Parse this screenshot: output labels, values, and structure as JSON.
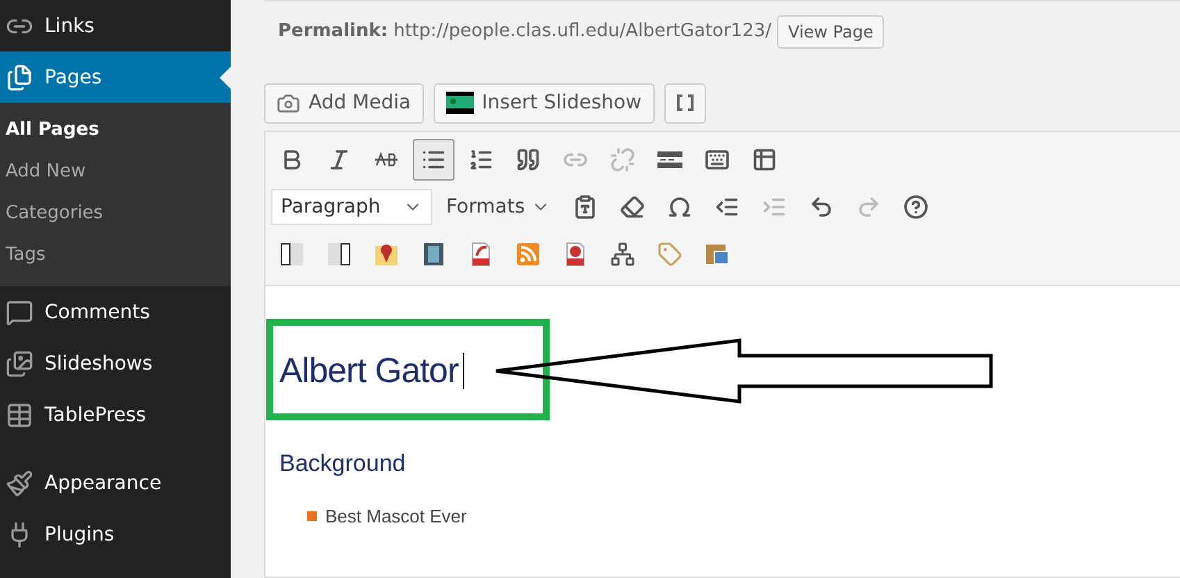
{
  "sidebar": {
    "groups": [
      [
        {
          "label": "Links",
          "kind": "link",
          "selected": false
        },
        {
          "label": "Pages",
          "kind": "pages",
          "selected": true,
          "children": [
            {
              "label": "All Pages",
              "selected": true
            },
            {
              "label": "Add New",
              "selected": false
            },
            {
              "label": "Categories",
              "selected": false
            },
            {
              "label": "Tags",
              "selected": false
            }
          ]
        },
        {
          "label": "Comments",
          "kind": "comment",
          "selected": false
        },
        {
          "label": "Slideshows",
          "kind": "slides",
          "selected": false
        },
        {
          "label": "TablePress",
          "kind": "table",
          "selected": false
        }
      ],
      [
        {
          "label": "Appearance",
          "kind": "brush",
          "selected": false
        },
        {
          "label": "Plugins",
          "kind": "plug",
          "selected": false
        }
      ]
    ]
  },
  "permalink": {
    "label": "Permalink:",
    "url": "http://people.clas.ufl.edu/AlbertGator123/",
    "button": "View Page"
  },
  "media_buttons": [
    {
      "kind": "media",
      "label": "Add Media"
    },
    {
      "kind": "slideshow",
      "label": "Insert Slideshow"
    },
    {
      "kind": "brackets"
    }
  ],
  "toolbar_row_1": [
    {
      "kind": "bold",
      "active": false,
      "disabled": false
    },
    {
      "kind": "italic",
      "active": false,
      "disabled": false
    },
    {
      "kind": "strike",
      "active": false,
      "disabled": false
    },
    {
      "kind": "bullets",
      "active": true,
      "disabled": false
    },
    {
      "kind": "numbers",
      "active": false,
      "disabled": false
    },
    {
      "kind": "quote",
      "active": false,
      "disabled": false
    },
    {
      "kind": "link",
      "active": false,
      "disabled": true
    },
    {
      "kind": "unlink",
      "active": false,
      "disabled": true
    },
    {
      "kind": "more",
      "active": false,
      "disabled": false
    },
    {
      "kind": "keyboard",
      "active": false,
      "disabled": false
    },
    {
      "kind": "table",
      "active": false,
      "disabled": false
    }
  ],
  "format_select": {
    "value": "Paragraph"
  },
  "formats_menu": {
    "label": "Formats"
  },
  "toolbar_row_2": [
    {
      "kind": "paste",
      "disabled": false
    },
    {
      "kind": "eraser",
      "disabled": false
    },
    {
      "kind": "omega",
      "disabled": false
    },
    {
      "kind": "outdent",
      "disabled": false
    },
    {
      "kind": "indent",
      "disabled": true
    },
    {
      "kind": "undo",
      "disabled": false
    },
    {
      "kind": "redo",
      "disabled": true
    },
    {
      "kind": "help",
      "disabled": false
    }
  ],
  "toolbar_row_3": [
    {
      "kind": "col-left"
    },
    {
      "kind": "col-right"
    },
    {
      "kind": "map"
    },
    {
      "kind": "film"
    },
    {
      "kind": "flv"
    },
    {
      "kind": "rss"
    },
    {
      "kind": "swf"
    },
    {
      "kind": "sitemap"
    },
    {
      "kind": "tag"
    },
    {
      "kind": "gallery"
    }
  ],
  "content": {
    "title": "Albert Gator",
    "heading": "Background",
    "bullets": [
      "Best Mascot Ever"
    ]
  }
}
